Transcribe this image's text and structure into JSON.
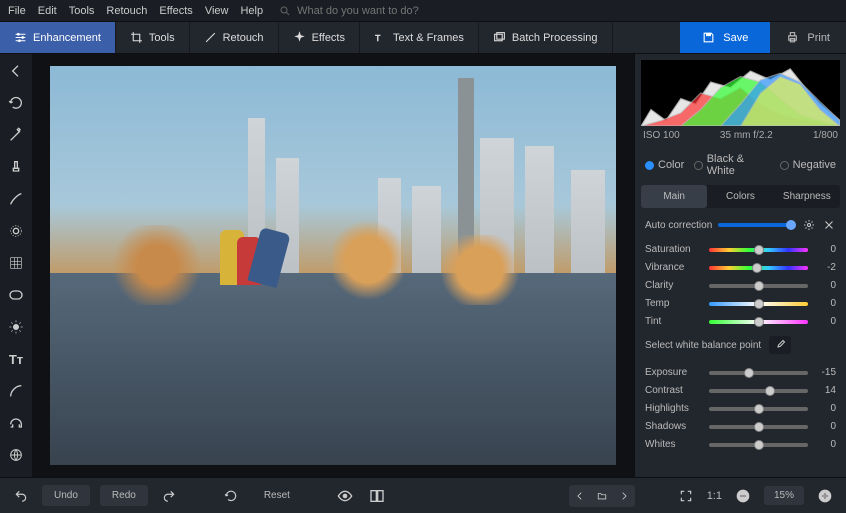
{
  "menu": [
    "File",
    "Edit",
    "Tools",
    "Retouch",
    "Effects",
    "View",
    "Help"
  ],
  "search_placeholder": "What do you want to do?",
  "tabs": {
    "enhancement": "Enhancement",
    "tools": "Tools",
    "retouch": "Retouch",
    "effects": "Effects",
    "text": "Text & Frames",
    "batch": "Batch Processing"
  },
  "save": "Save",
  "print": "Print",
  "meta": {
    "iso": "ISO 100",
    "lens": "35 mm f/2.2",
    "shutter": "1/800"
  },
  "radios": {
    "color": "Color",
    "bw": "Black & White",
    "neg": "Negative"
  },
  "subtabs": {
    "main": "Main",
    "colors": "Colors",
    "sharp": "Sharpness"
  },
  "auto": "Auto correction",
  "sliders": {
    "sat": {
      "label": "Saturation",
      "val": "0",
      "pos": 50,
      "cls": "rainbow"
    },
    "vib": {
      "label": "Vibrance",
      "val": "-2",
      "pos": 48,
      "cls": "rainbow"
    },
    "clar": {
      "label": "Clarity",
      "val": "0",
      "pos": 50,
      "cls": ""
    },
    "temp": {
      "label": "Temp",
      "val": "0",
      "pos": 50,
      "cls": "temp"
    },
    "tint": {
      "label": "Tint",
      "val": "0",
      "pos": 50,
      "cls": "tint"
    },
    "exp": {
      "label": "Exposure",
      "val": "-15",
      "pos": 40,
      "cls": ""
    },
    "con": {
      "label": "Contrast",
      "val": "14",
      "pos": 62,
      "cls": ""
    },
    "hi": {
      "label": "Highlights",
      "val": "0",
      "pos": 50,
      "cls": ""
    },
    "sh": {
      "label": "Shadows",
      "val": "0",
      "pos": 50,
      "cls": ""
    },
    "wh": {
      "label": "Whites",
      "val": "0",
      "pos": 50,
      "cls": ""
    }
  },
  "wb": "Select white balance point",
  "bottom": {
    "undo": "Undo",
    "redo": "Redo",
    "reset": "Reset",
    "fit": "1:1",
    "zoom": "15%"
  }
}
